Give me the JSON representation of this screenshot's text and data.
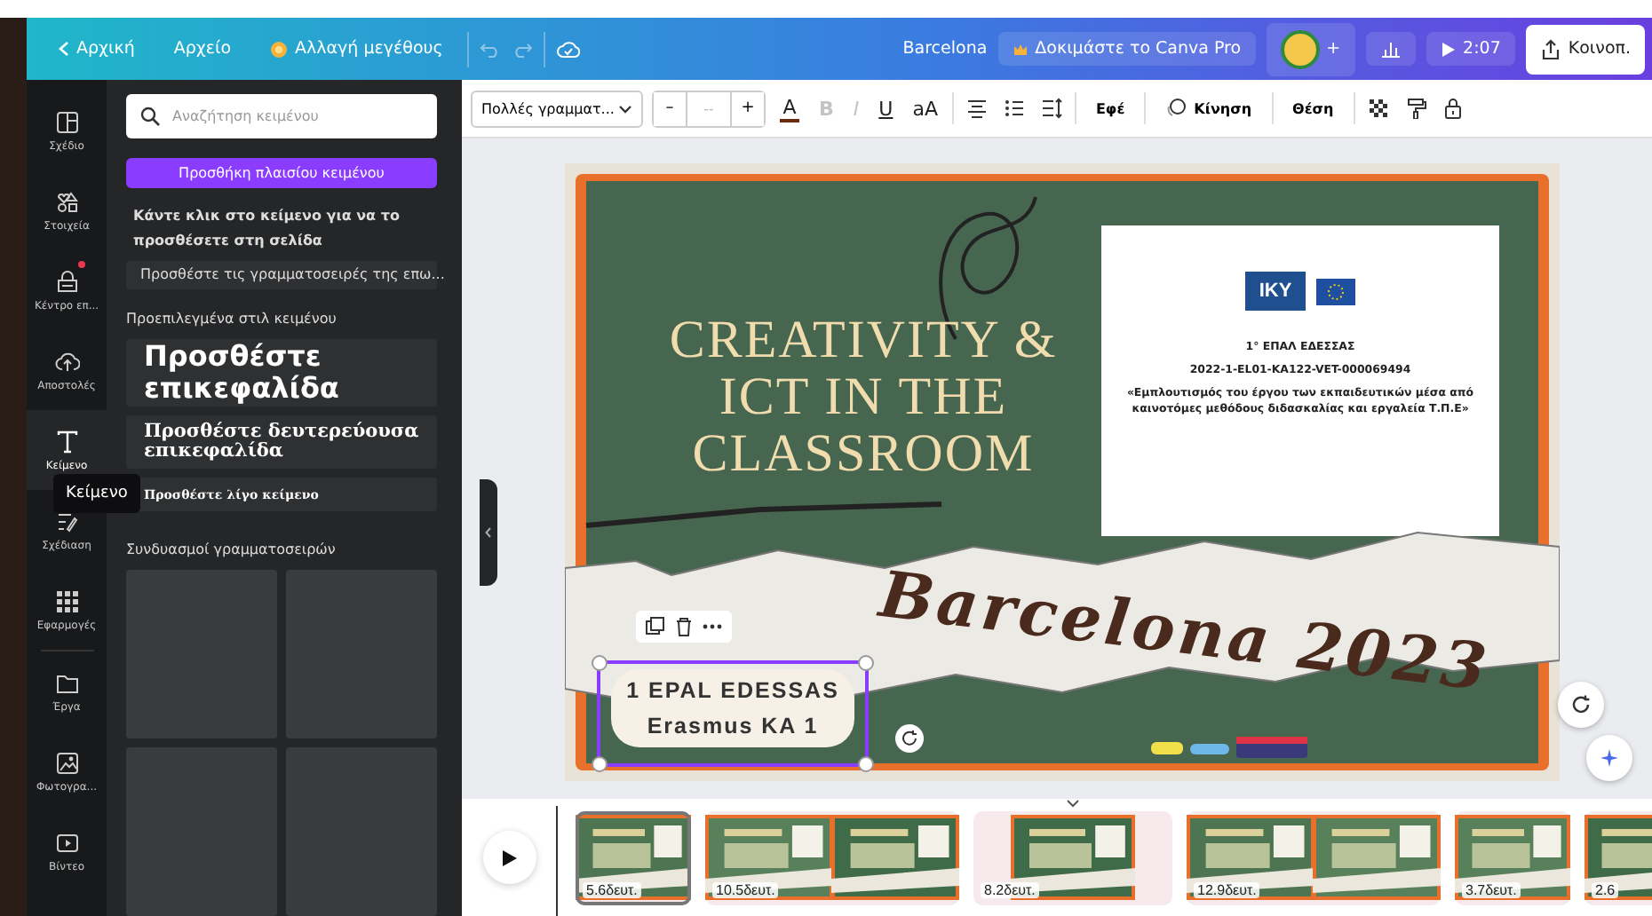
{
  "topbar": {
    "back": "Αρχική",
    "file": "Αρχείο",
    "resize": "Αλλαγή μεγέθους",
    "title": "Barcelona",
    "pro": "Δοκιμάστε το Canva Pro",
    "add": "+",
    "duration": "2:07",
    "share": "Κοινοπ."
  },
  "rail": [
    {
      "kind": "layout",
      "label": "Σχέδιο",
      "selected": false
    },
    {
      "kind": "elements",
      "label": "Στοιχεία",
      "selected": false
    },
    {
      "kind": "brand",
      "label": "Κέντρο επ...",
      "selected": false
    },
    {
      "kind": "upload",
      "label": "Αποστολές",
      "selected": false
    },
    {
      "kind": "text",
      "label": "Κείμενο",
      "selected": true
    },
    {
      "kind": "draw",
      "label": "Σχέδιαση",
      "selected": false
    },
    {
      "kind": "apps",
      "label": "Εφαρμογές",
      "selected": false
    },
    {
      "kind": "projects",
      "label": "Έργα",
      "selected": false
    },
    {
      "kind": "photos",
      "label": "Φωτογρα...",
      "selected": false
    },
    {
      "kind": "video",
      "label": "Βίντεο",
      "selected": false
    }
  ],
  "tooltip": "Κείμενο",
  "panel": {
    "search_placeholder": "Αναζήτηση κειμένου",
    "add_button": "Προσθήκη πλαισίου κειμένου",
    "hint": "Κάντε κλικ στο κείμενο για να το προσθέσετε στη σελίδα",
    "brand_fonts": "Προσθέστε τις γραμματοσειρές της επω...",
    "styles_heading": "Προεπιλεγμένα στιλ κειμένου",
    "styles": [
      {
        "kind": "heading",
        "text": "Προσθέστε επικεφαλίδα"
      },
      {
        "kind": "subheading",
        "text": "Προσθέστε δευτερεύουσα επικεφαλίδα"
      },
      {
        "kind": "body",
        "text": "Προσθέστε λίγο κείμενο"
      }
    ],
    "combos_heading": "Συνδυασμοί γραμματοσειρών"
  },
  "toolbar": {
    "font": "Πολλές γραμματ...",
    "minus": "–",
    "size": "--",
    "plus": "+",
    "format": [
      {
        "kind": "color",
        "text": "A",
        "disabled": false
      },
      {
        "kind": "bold",
        "text": "B",
        "disabled": true
      },
      {
        "kind": "italic",
        "text": "I",
        "disabled": true
      },
      {
        "kind": "underline",
        "text": "U",
        "disabled": false
      },
      {
        "kind": "case",
        "text": "aA",
        "disabled": false
      }
    ],
    "effects": "Εφέ",
    "animate": "Κίνηση",
    "position": "Θέση"
  },
  "slide": {
    "title": [
      "CREATIVITY &",
      "ICT IN THE",
      "CLASSROOM"
    ],
    "info": {
      "logo": "IKY",
      "lines": [
        "1° ΕΠΑΛ ΕΔΕΣΣΑΣ",
        "2022-1-EL01-KA122-VET-000069494",
        "«Εμπλουτισμός του έργου των εκπαιδευτικών μέσα από καινοτόμες μεθόδους διδασκαλίας και εργαλεία Τ.Π.Ε»"
      ]
    },
    "script": "Barcelona 2023",
    "label": {
      "lines": [
        "1 EPAL EDESSAS",
        "Erasmus KA 1"
      ],
      "selected": true
    }
  },
  "timeline": {
    "clips": [
      {
        "kind": "single",
        "duration": "5.6δευτ.",
        "selected": true
      },
      {
        "kind": "double",
        "duration": "10.5δευτ.",
        "selected": false
      },
      {
        "kind": "framed",
        "duration": "8.2δευτ.",
        "selected": false
      },
      {
        "kind": "double",
        "duration": "12.9δευτ.",
        "selected": false
      },
      {
        "kind": "single",
        "duration": "3.7δευτ.",
        "selected": false
      },
      {
        "kind": "single",
        "duration": "2.6",
        "selected": false
      }
    ]
  }
}
